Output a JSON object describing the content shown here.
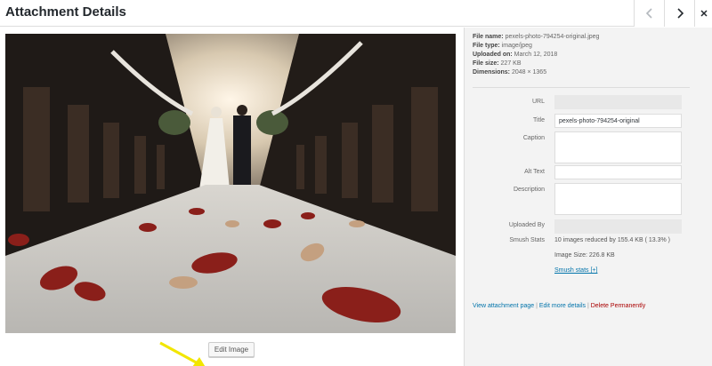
{
  "header": {
    "title": "Attachment Details",
    "prev_icon": "chevron-left-icon",
    "next_icon": "chevron-right-icon",
    "close_icon": "close-icon"
  },
  "media": {
    "edit_button_label": "Edit Image"
  },
  "file_info": {
    "file_name_label": "File name:",
    "file_name": "pexels-photo-794254-original.jpeg",
    "file_type_label": "File type:",
    "file_type": "image/jpeg",
    "uploaded_on_label": "Uploaded on:",
    "uploaded_on": "March 12, 2018",
    "file_size_label": "File size:",
    "file_size": "227 KB",
    "dimensions_label": "Dimensions:",
    "dimensions": "2048 × 1365"
  },
  "fields": {
    "url_label": "URL",
    "url_value": "",
    "title_label": "Title",
    "title_value": "pexels-photo-794254-original",
    "caption_label": "Caption",
    "caption_value": "",
    "alt_label": "Alt Text",
    "alt_value": "",
    "description_label": "Description",
    "description_value": "",
    "uploaded_by_label": "Uploaded By",
    "uploaded_by_value": ""
  },
  "smush": {
    "label": "Smush Stats",
    "summary": "10 images reduced by 155.4 KB ( 13.3% )",
    "image_size": "Image Size: 226.8 KB",
    "link": "Smush stats [+]"
  },
  "actions": {
    "view_page": "View attachment page",
    "separator": " | ",
    "edit_more": "Edit more details",
    "delete": "Delete Permanently"
  },
  "colors": {
    "link": "#0073aa",
    "delete": "#a00000",
    "arrow": "#f2e600"
  }
}
